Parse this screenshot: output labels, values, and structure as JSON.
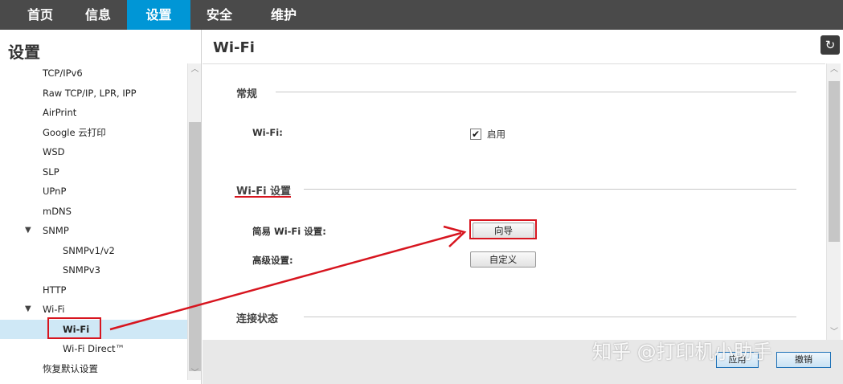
{
  "nav": {
    "tabs": [
      {
        "label": "首页"
      },
      {
        "label": "信息"
      },
      {
        "label": "设置"
      },
      {
        "label": "安全"
      },
      {
        "label": "维护"
      }
    ],
    "active_tab": "设置"
  },
  "sidebar": {
    "title": "设置",
    "items": [
      {
        "label": "TCP/IPv6"
      },
      {
        "label": "Raw TCP/IP, LPR, IPP"
      },
      {
        "label": "AirPrint"
      },
      {
        "label": "Google 云打印"
      },
      {
        "label": "WSD"
      },
      {
        "label": "SLP"
      },
      {
        "label": "UPnP"
      },
      {
        "label": "mDNS"
      },
      {
        "label": "SNMP",
        "caret": "▼"
      },
      {
        "label": "SNMPv1/v2"
      },
      {
        "label": "SNMPv3"
      },
      {
        "label": "HTTP"
      },
      {
        "label": "Wi-Fi",
        "caret": "▼"
      },
      {
        "label": "Wi-Fi",
        "selected": true
      },
      {
        "label": "Wi-Fi Direct™"
      },
      {
        "label": "恢复默认设置"
      }
    ]
  },
  "main": {
    "title": "Wi-Fi",
    "refresh_icon": "↻",
    "sections": {
      "general": {
        "title": "常规"
      },
      "wifi_settings": {
        "title": "Wi-Fi 设置"
      },
      "connection_status": {
        "title": "连接状态"
      }
    },
    "wifi_field": {
      "label": "Wi-Fi:",
      "checked": true,
      "check_mark": "✔",
      "option_label": "启用"
    },
    "easy_setup": {
      "label": "简易 Wi-Fi 设置:",
      "button": "向导"
    },
    "advanced": {
      "label": "高级设置:",
      "button": "自定义"
    },
    "footer": {
      "apply": "应用",
      "cancel": "撤销"
    }
  },
  "scroll_arrows": {
    "up": "︿",
    "down": "﹀"
  },
  "watermark": "知乎 @打印机小助手",
  "colors": {
    "active_tab": "#0096d6",
    "nav_bg": "#4a4a4a",
    "annotation_red": "#d7151f",
    "selected_row": "#cfe8f6"
  }
}
